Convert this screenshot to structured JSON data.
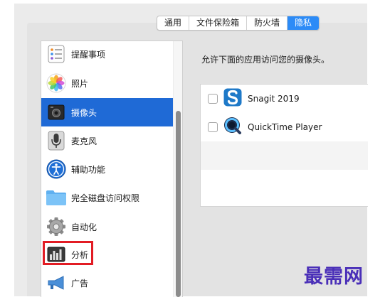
{
  "tabs": [
    {
      "label": "通用",
      "active": false
    },
    {
      "label": "文件保险箱",
      "active": false
    },
    {
      "label": "防火墙",
      "active": false
    },
    {
      "label": "隐私",
      "active": true
    }
  ],
  "sidebar": {
    "items": [
      {
        "label": "提醒事项",
        "icon": "reminders-icon"
      },
      {
        "label": "照片",
        "icon": "photos-icon"
      },
      {
        "label": "摄像头",
        "icon": "camera-icon",
        "selected": true
      },
      {
        "label": "麦克风",
        "icon": "microphone-icon"
      },
      {
        "label": "辅助功能",
        "icon": "accessibility-icon"
      },
      {
        "label": "完全磁盘访问权限",
        "icon": "folder-icon"
      },
      {
        "label": "自动化",
        "icon": "gear-icon"
      },
      {
        "label": "分析",
        "icon": "analytics-icon",
        "highlighted": true
      },
      {
        "label": "广告",
        "icon": "megaphone-icon"
      }
    ]
  },
  "main": {
    "description": "允许下面的应用访问您的摄像头。",
    "apps": [
      {
        "name": "Snagit 2019",
        "checked": false,
        "icon": "snagit-icon"
      },
      {
        "name": "QuickTime Player",
        "checked": false,
        "icon": "quicktime-icon"
      }
    ]
  },
  "watermark": "最需网",
  "colors": {
    "accent": "#2c8bf7",
    "selection": "#1f6ad6",
    "highlight_box": "#e21c24",
    "watermark": "#4a2fb8"
  }
}
